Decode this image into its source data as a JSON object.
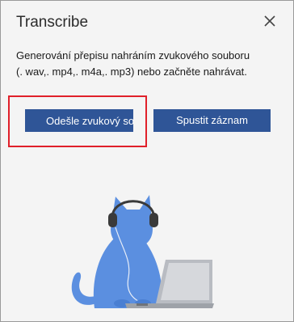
{
  "panel": {
    "title": "Transcribe",
    "description": "Generování přepisu nahráním zvukového souboru (. wav,. mp4,. m4a,. mp3) nebo začněte nahrávat.",
    "upload_button_label": "Odešle zvukový soubor",
    "record_button_label": "Spustit záznam"
  },
  "colors": {
    "accent": "#2f5597",
    "highlight": "#e0202a",
    "cat": "#5b8fe0",
    "background": "#f4f4f4"
  },
  "icons": {
    "close": "close-icon",
    "illustration": "cat-with-headphones-and-laptop"
  }
}
